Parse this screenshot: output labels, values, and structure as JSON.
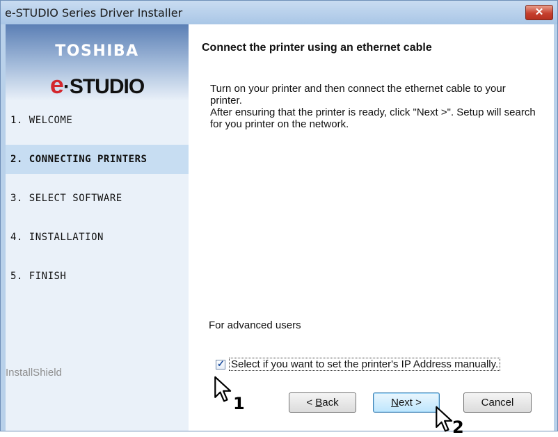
{
  "window": {
    "title": "e-STUDIO Series Driver Installer",
    "close_glyph": "✕"
  },
  "brand": {
    "company": "TOSHIBA",
    "product_e": "e",
    "product_rest": "·STUDIO"
  },
  "sidebar": {
    "steps": [
      {
        "label": "1. WELCOME",
        "active": false
      },
      {
        "label": "2. CONNECTING PRINTERS",
        "active": true
      },
      {
        "label": "3. SELECT SOFTWARE",
        "active": false
      },
      {
        "label": "4. INSTALLATION",
        "active": false
      },
      {
        "label": "5. FINISH",
        "active": false
      }
    ],
    "footer": "InstallShield"
  },
  "main": {
    "heading": "Connect the printer using an ethernet cable",
    "paragraph1": "Turn on your printer and then connect the ethernet cable to your printer.",
    "paragraph2": "After ensuring that the printer is ready, click \"Next >\". Setup will search for  you printer on the network.",
    "advanced_label": "For advanced users",
    "manual_ip_checkbox": {
      "label": "Select if you want to set the printer's IP Address manually.",
      "checked": true
    }
  },
  "buttons": {
    "back": {
      "mnemonic": "B",
      "rest": "ack",
      "prefix": "< "
    },
    "next": {
      "mnemonic": "N",
      "rest": "ext >"
    },
    "cancel": "Cancel"
  },
  "callouts": {
    "first": "1",
    "second": "2"
  }
}
